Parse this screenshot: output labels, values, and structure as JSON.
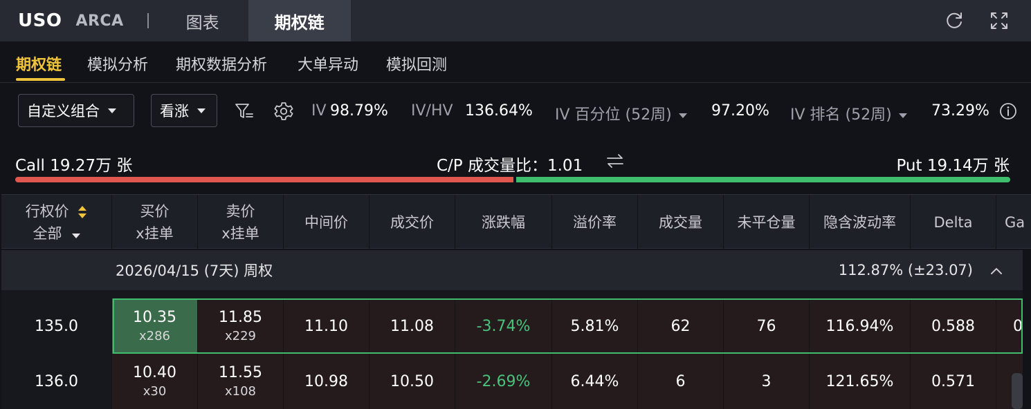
{
  "header": {
    "ticker": "USO",
    "exchange": "ARCA",
    "tabs": [
      {
        "label": "图表",
        "active": false
      },
      {
        "label": "期权链",
        "active": true
      }
    ],
    "icons": [
      "refresh-icon",
      "fullscreen-icon"
    ]
  },
  "subnav": {
    "tabs": [
      {
        "label": "期权链",
        "active": true
      },
      {
        "label": "模拟分析"
      },
      {
        "label": "期权数据分析"
      },
      {
        "label": "大单异动"
      },
      {
        "label": "模拟回测"
      }
    ]
  },
  "toolbar": {
    "strategy_select": "自定义组合",
    "direction_select": "看涨",
    "icons": [
      "filter-icon",
      "settings-icon",
      "info-icon"
    ],
    "iv_label": "IV",
    "iv_value": "98.79%",
    "ivhv_label": "IV/HV",
    "ivhv_value": "136.64%",
    "iv_pct_label": "IV 百分位 (52周)",
    "iv_pct_value": "97.20%",
    "iv_rank_label": "IV 排名 (52周)",
    "iv_rank_value": "73.29%"
  },
  "volume": {
    "call_label": "Call 19.27万 张",
    "ratio_label": "C/P 成交量比：1.01",
    "put_label": "Put 19.14万 张",
    "call_share": 0.502,
    "colors": {
      "call": "#e0574f",
      "put": "#3fbf6e"
    }
  },
  "table": {
    "strike_header": "行权价",
    "strike_filter": "全部",
    "columns": [
      {
        "line1": "买价",
        "line2": "x挂单"
      },
      {
        "line1": "卖价",
        "line2": "x挂单"
      },
      {
        "line1": "中间价"
      },
      {
        "line1": "成交价"
      },
      {
        "line1": "涨跌幅"
      },
      {
        "line1": "溢价率"
      },
      {
        "line1": "成交量"
      },
      {
        "line1": "未平仓量"
      },
      {
        "line1": "隐含波动率"
      },
      {
        "line1": "Delta"
      },
      {
        "line1": "Ga"
      }
    ],
    "group": {
      "title": "2026/04/15 (7天) 周权",
      "iv": "112.87%  (±23.07)"
    },
    "rows": [
      {
        "strike": "135.0",
        "bid": "10.35",
        "bid_size": "x286",
        "ask": "11.85",
        "ask_size": "x229",
        "mid": "11.10",
        "last": "11.08",
        "change": "-3.74%",
        "premium": "5.81%",
        "volume": "62",
        "oi": "76",
        "iv": "116.94%",
        "delta": "0.588",
        "gamma": "0"
      },
      {
        "strike": "136.0",
        "bid": "10.40",
        "bid_size": "x30",
        "ask": "11.55",
        "ask_size": "x108",
        "mid": "10.98",
        "last": "10.50",
        "change": "-2.69%",
        "premium": "6.44%",
        "volume": "6",
        "oi": "3",
        "iv": "121.65%",
        "delta": "0.571",
        "gamma": ""
      }
    ]
  }
}
